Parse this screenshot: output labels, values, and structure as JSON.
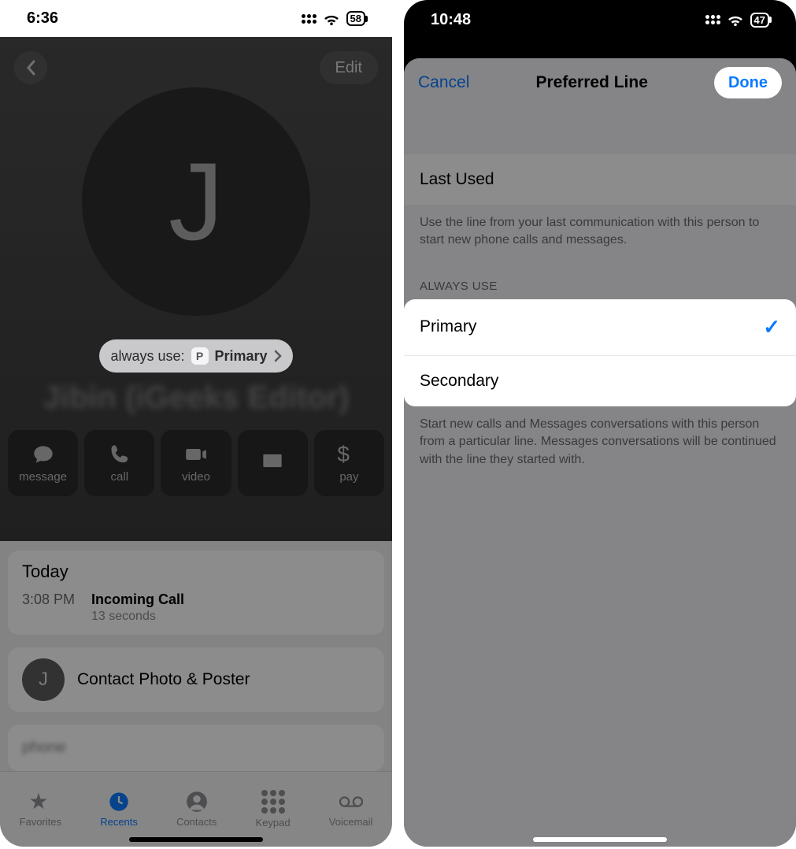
{
  "left": {
    "status": {
      "time": "6:36",
      "battery": "58"
    },
    "header": {
      "edit": "Edit"
    },
    "avatar_letter": "J",
    "line_pill": {
      "prefix": "always use:",
      "badge": "P",
      "line": "Primary"
    },
    "contact_name": "Jibin (iGeeks Editor)",
    "actions": {
      "message": "message",
      "call": "call",
      "video": "video",
      "mail": "",
      "pay": "pay"
    },
    "today": {
      "header": "Today",
      "time": "3:08 PM",
      "title": "Incoming Call",
      "duration": "13 seconds"
    },
    "poster": {
      "initial": "J",
      "label": "Contact Photo & Poster"
    },
    "phone_label": "phone",
    "tabs": {
      "favorites": "Favorites",
      "recents": "Recents",
      "contacts": "Contacts",
      "keypad": "Keypad",
      "voicemail": "Voicemail"
    }
  },
  "right": {
    "status": {
      "time": "10:48",
      "battery": "47"
    },
    "sheet": {
      "cancel": "Cancel",
      "title": "Preferred Line",
      "done": "Done",
      "last_used_header": "Last Used",
      "last_used_footer": "Use the line from your last communication with this person to start new phone calls and messages.",
      "always_use_header": "ALWAYS USE",
      "options": {
        "primary": "Primary",
        "secondary": "Secondary"
      },
      "options_footer": "Start new calls and Messages conversations with this person from a particular line. Messages conversations will be continued with the line they started with."
    }
  }
}
